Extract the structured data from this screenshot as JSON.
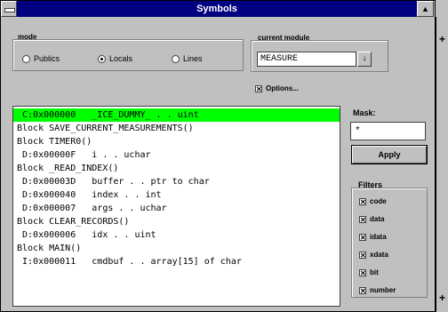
{
  "window": {
    "title": "Symbols",
    "maximize_glyph": "▲"
  },
  "mode": {
    "label": "mode",
    "options": [
      {
        "label": "Publics",
        "selected": false
      },
      {
        "label": "Locals",
        "selected": true
      },
      {
        "label": "Lines",
        "selected": false
      }
    ]
  },
  "module": {
    "label": "current module",
    "value": "MEASURE",
    "dropdown_glyph": "↓"
  },
  "options": {
    "label": "Options...",
    "checked": true
  },
  "list": {
    "rows": [
      {
        "text": " C:0x000000   _ICE_DUMMY_ . . uint",
        "selected": true
      },
      {
        "text": "Block SAVE_CURRENT_MEASUREMENTS()",
        "selected": false
      },
      {
        "text": "Block TIMER0()",
        "selected": false
      },
      {
        "text": " D:0x00000F   i . . uchar",
        "selected": false
      },
      {
        "text": "Block _READ_INDEX()",
        "selected": false
      },
      {
        "text": " D:0x00003D   buffer . . ptr to char",
        "selected": false
      },
      {
        "text": " D:0x000040   index . . int",
        "selected": false
      },
      {
        "text": " D:0x000007   args . . uchar",
        "selected": false
      },
      {
        "text": "Block CLEAR_RECORDS()",
        "selected": false
      },
      {
        "text": " D:0x000006   idx . . uint",
        "selected": false
      },
      {
        "text": "Block MAIN()",
        "selected": false
      },
      {
        "text": " I:0x000011   cmdbuf . . array[15] of char",
        "selected": false
      }
    ],
    "selected_color": "#00ff00"
  },
  "mask": {
    "label": "Mask:",
    "value": "*",
    "apply_label": "Apply"
  },
  "filters": {
    "label": "Filters",
    "items": [
      {
        "label": "code",
        "checked": true
      },
      {
        "label": "data",
        "checked": true
      },
      {
        "label": "idata",
        "checked": true
      },
      {
        "label": "xdata",
        "checked": true
      },
      {
        "label": "bit",
        "checked": true
      },
      {
        "label": "number",
        "checked": true
      }
    ]
  },
  "scrollbar": {
    "up_glyph": "+",
    "down_glyph": "+"
  },
  "colors": {
    "titlebar": "#000080",
    "face": "#c0c0c0",
    "highlight": "#00ff00"
  }
}
